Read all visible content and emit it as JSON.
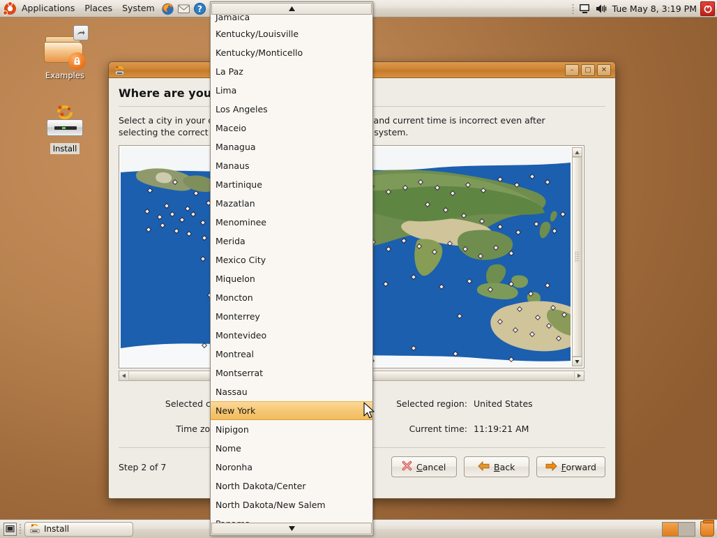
{
  "top_panel": {
    "menus": [
      "Applications",
      "Places",
      "System"
    ],
    "launchers": [
      "firefox-icon",
      "evolution-mail-icon",
      "help-icon"
    ],
    "tray_icons": [
      "display-icon",
      "volume-icon"
    ],
    "clock": "Tue May  8,  3:19 PM",
    "power_label": "power-icon"
  },
  "desktop": {
    "icons": [
      {
        "label": "Examples",
        "icon": "folder-icon",
        "badges": [
          "link-badge",
          "lock-badge"
        ]
      },
      {
        "label": "Install",
        "icon": "cd-install-icon",
        "badges": []
      }
    ]
  },
  "window": {
    "title": "",
    "controls": {
      "minimize": "–",
      "maximize": "□",
      "close": "✕"
    },
    "page_title": "Where are you?",
    "description": "Select a city in your country and region. The selected city and current time is incorrect even after selecting the correct city after rebooting into the installed system.",
    "description_left_visible": "Select a city in your c",
    "description_right_visible": "d current time is incorrect even",
    "fields": {
      "selected_city_label": "Selected city:",
      "selected_city_value": "",
      "time_zone_label": "Time zone:",
      "time_zone_value": "",
      "selected_region_label": "Selected region:",
      "selected_region_value": "United States",
      "current_time_label": "Current time:",
      "current_time_value": "11:19:21 AM"
    },
    "step_label": "Step 2 of 7",
    "buttons": [
      {
        "name": "cancel",
        "pre": "",
        "accel": "C",
        "post": "ancel",
        "icon": "cancel-x-icon"
      },
      {
        "name": "back",
        "pre": "",
        "accel": "B",
        "post": "ack",
        "icon": "arrow-left-icon"
      },
      {
        "name": "forward",
        "pre": "",
        "accel": "F",
        "post": "orward",
        "icon": "arrow-right-icon"
      }
    ]
  },
  "dropdown": {
    "scroll_up": "▲",
    "scroll_down": "▼",
    "selected": "New York",
    "items": [
      "Jamaica",
      "Kentucky/Louisville",
      "Kentucky/Monticello",
      "La Paz",
      "Lima",
      "Los Angeles",
      "Maceio",
      "Managua",
      "Manaus",
      "Martinique",
      "Mazatlan",
      "Menominee",
      "Merida",
      "Mexico City",
      "Miquelon",
      "Moncton",
      "Monterrey",
      "Montevideo",
      "Montreal",
      "Montserrat",
      "Nassau",
      "New York",
      "Nipigon",
      "Nome",
      "Noronha",
      "North Dakota/Center",
      "North Dakota/New Salem",
      "Panama"
    ]
  },
  "bottom_panel": {
    "task_label": "Install",
    "task_icon": "cd-install-icon",
    "show_desktop_icon": "show-desktop-icon",
    "workspaces": 2,
    "active_workspace": 1,
    "trash_icon": "trash-icon"
  },
  "colors": {
    "accent": "#dd4814",
    "titlebar": "#cf8434",
    "selection": "#f6c874",
    "panel": "#e6e1d8",
    "desktop": "#b8824f",
    "map_ocean": "#1b5fae",
    "map_land": "#6b8b4a"
  }
}
